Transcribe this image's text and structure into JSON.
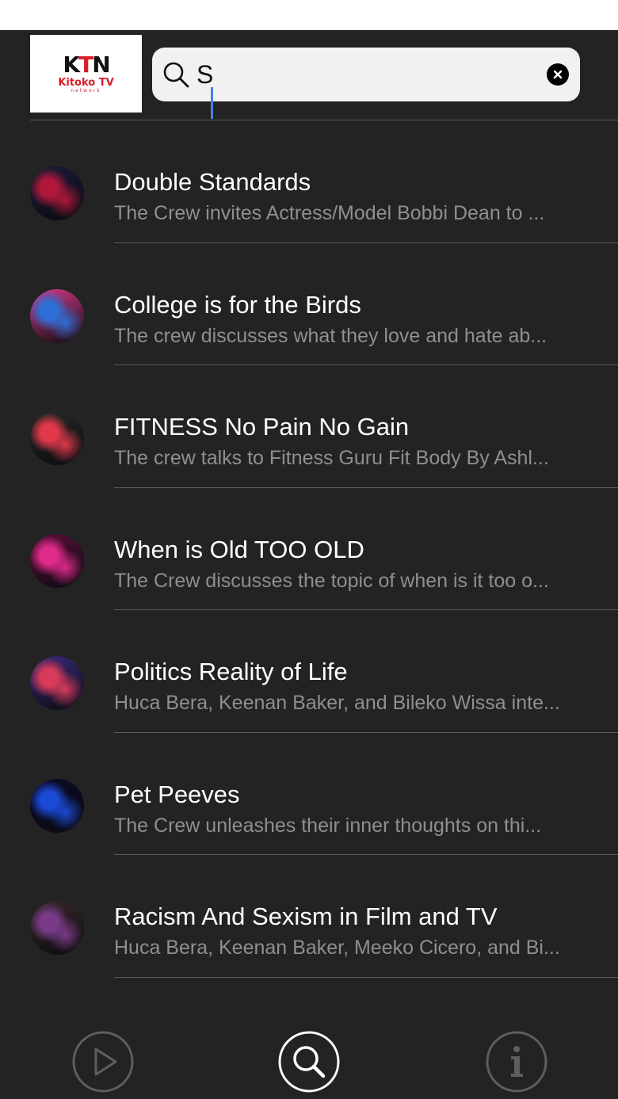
{
  "header": {
    "logo": {
      "mark": "KTN",
      "name": "Kitoko TV",
      "sub": "network"
    },
    "search": {
      "value": "S",
      "search_icon": "search-icon",
      "clear_icon": "close-icon"
    }
  },
  "results": [
    {
      "title": "Double Standards",
      "description": "The Crew invites Actress/Model Bobbi Dean to ...",
      "thumb_colors": [
        "#b0173a",
        "#1b1b3a"
      ]
    },
    {
      "title": "College is for the Birds",
      "description": "The crew discusses what they love and hate ab...",
      "thumb_colors": [
        "#2d6fd6",
        "#d63a8a"
      ]
    },
    {
      "title": "FITNESS No Pain No Gain",
      "description": "The crew talks to Fitness Guru Fit Body By Ashl...",
      "thumb_colors": [
        "#e0384a",
        "#2a2a2a"
      ]
    },
    {
      "title": "When is Old TOO OLD",
      "description": "The Crew discusses the topic of when is it too o...",
      "thumb_colors": [
        "#e02a8a",
        "#5a0f3a"
      ]
    },
    {
      "title": "Politics Reality of Life",
      "description": "Huca Bera, Keenan Baker, and Bileko Wissa inte...",
      "thumb_colors": [
        "#d83a5a",
        "#3a2a7a"
      ]
    },
    {
      "title": "Pet Peeves",
      "description": "The Crew unleashes their inner thoughts on thi...",
      "thumb_colors": [
        "#1a4ad6",
        "#0a0a2a"
      ]
    },
    {
      "title": "Racism And Sexism in Film and TV",
      "description": "Huca Bera, Keenan Baker, Meeko Cicero, and Bi...",
      "thumb_colors": [
        "#7a3a8a",
        "#3a2a2a"
      ]
    }
  ],
  "tabbar": {
    "tabs": [
      {
        "icon": "play-icon",
        "active": false
      },
      {
        "icon": "search-icon",
        "active": true
      },
      {
        "icon": "info-icon",
        "active": false
      }
    ],
    "colors": {
      "active": "#ffffff",
      "inactive": "#5e5e5e"
    }
  },
  "colors": {
    "background": "#232323",
    "divider": "#5a5a5a",
    "subtitle": "#8f8f8f",
    "caret": "#4a7fe0"
  }
}
